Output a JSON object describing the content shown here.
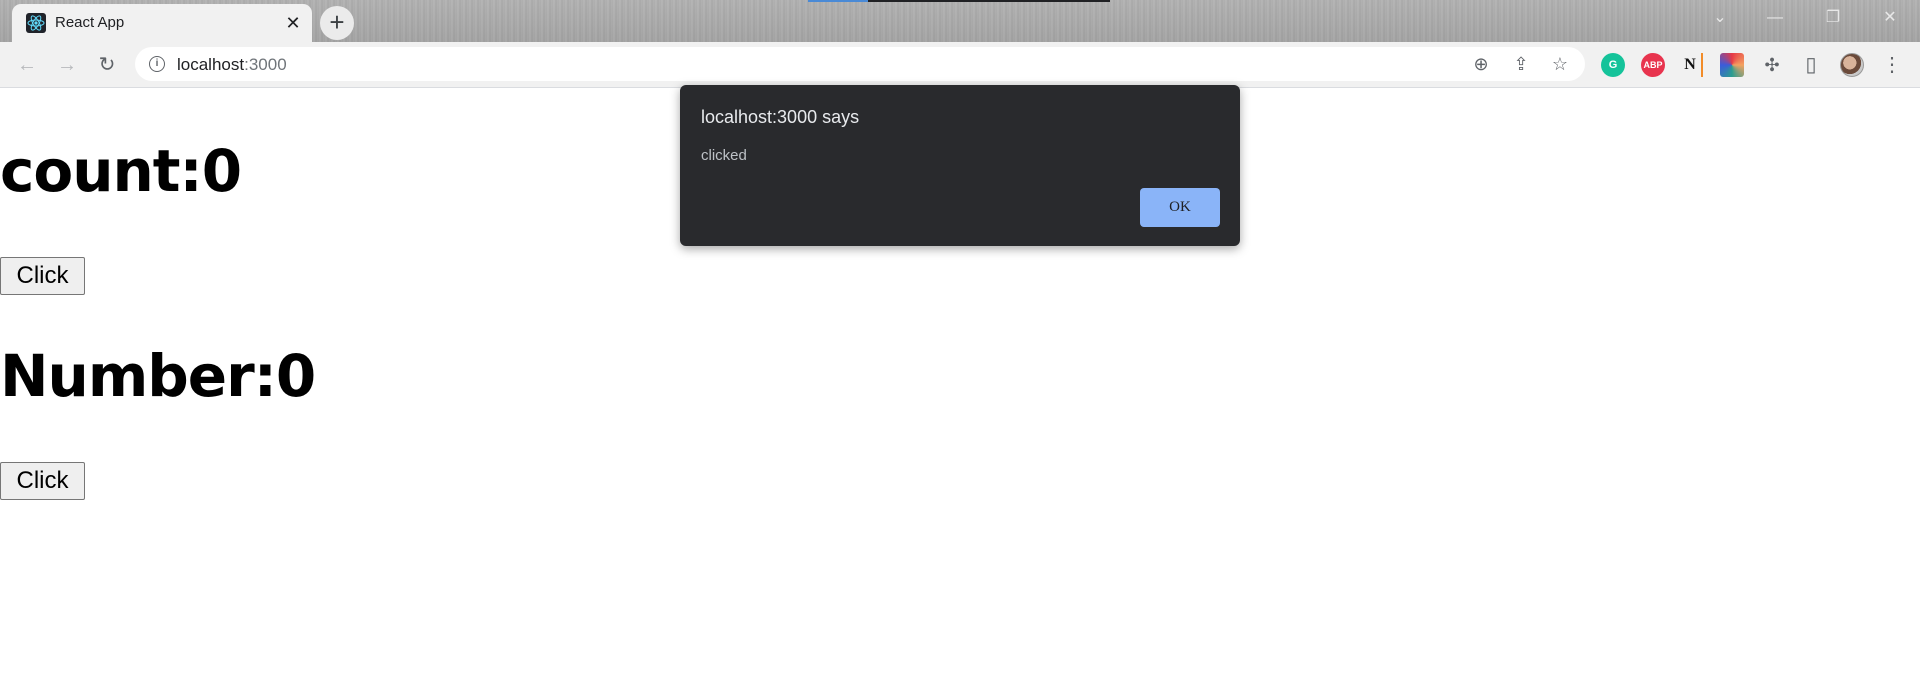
{
  "browser": {
    "tab": {
      "title": "React App",
      "close_glyph": "✕",
      "favicon": "react-logo-icon"
    },
    "new_tab_glyph": "+",
    "window_controls": {
      "dropdown": "⌄",
      "minimize": "—",
      "restore": "❐",
      "close": "✕"
    },
    "nav": {
      "back": "←",
      "forward": "→",
      "reload": "↻"
    },
    "address": {
      "host": "localhost",
      "port": ":3000"
    },
    "omnibox_icons": {
      "zoom": "⊕",
      "share": "⇪",
      "bookmark": "☆"
    },
    "extensions": [
      {
        "name": "grammarly-icon",
        "label": "G",
        "color": "#15c39a"
      },
      {
        "name": "adblock-plus-icon",
        "label": "ABP",
        "color": "#e8344e"
      },
      {
        "name": "notion-icon",
        "label": "N",
        "color": "#ffffff"
      },
      {
        "name": "extension-colorful-icon",
        "label": "",
        "color": "#3b5bdb"
      }
    ],
    "toolbar_icons": {
      "puzzle": "✣",
      "sidepanel": "▯",
      "menu": "⋮"
    }
  },
  "page": {
    "count_heading": "count:0",
    "click_button_1": "Click",
    "number_heading": "Number:0",
    "click_button_2": "Click"
  },
  "dialog": {
    "title": "localhost:3000 says",
    "message": "clicked",
    "ok_label": "OK"
  },
  "colors": {
    "dialog_bg": "#292a2d",
    "ok_button": "#8ab4f8",
    "grammarly": "#15c39a",
    "abp": "#e8344e"
  }
}
